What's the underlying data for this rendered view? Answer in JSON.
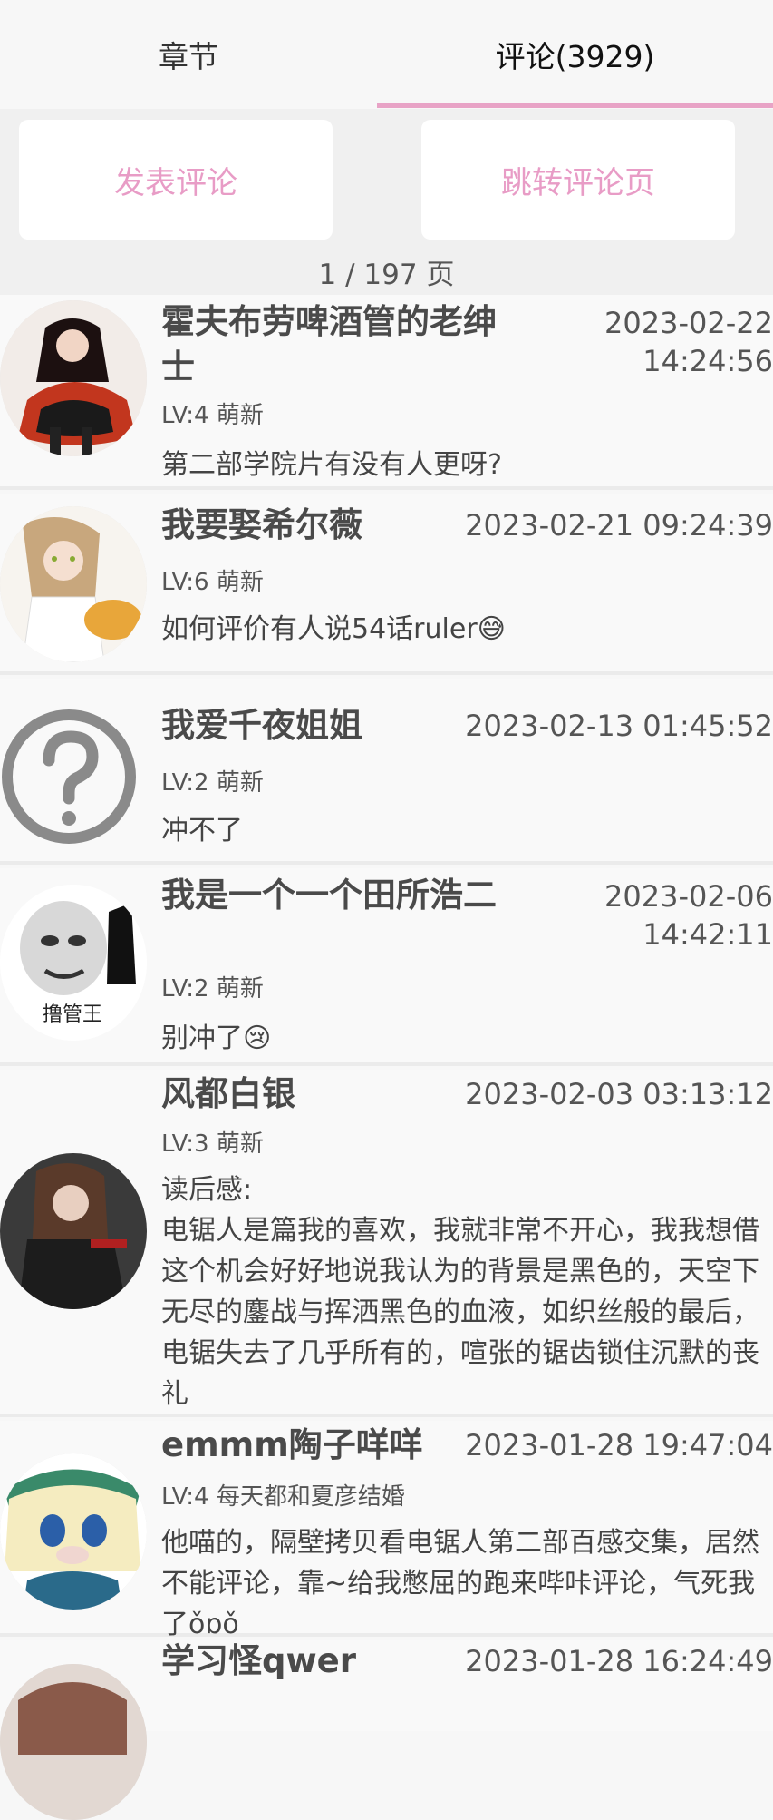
{
  "tabs": {
    "chapters": "章节",
    "comments": "评论(3929)"
  },
  "actions": {
    "post": "发表评论",
    "jump": "跳转评论页"
  },
  "pager": {
    "label": "1 / 197 页"
  },
  "comments": [
    {
      "user": "霍夫布劳啤酒管的老绅士",
      "date": "2023-02-22\n14:24:56",
      "level": "LV:4 萌新",
      "text": "第二部学院片有没有人更呀?"
    },
    {
      "user": "我要娶希尔薇",
      "date": "2023-02-21 09:24:39",
      "level": "LV:6 萌新",
      "text": "如何评价有人说54话ruler😅"
    },
    {
      "user": "我爱千夜姐姐",
      "date": "2023-02-13 01:45:52",
      "level": "LV:2 萌新",
      "text": "冲不了"
    },
    {
      "user": "我是一个一个田所浩二",
      "date": "2023-02-06\n14:42:11",
      "level": "LV:2 萌新",
      "text": "别冲了😢",
      "avatar_caption": "撸管王"
    },
    {
      "user": "风都白银",
      "date": "2023-02-03 03:13:12",
      "level": "LV:3 萌新",
      "text": "读后感:\n电锯人是篇我的喜欢，我就非常不开心，我我想借这个机会好好地说我认为的背景是黑色的，天空下无尽的鏖战与挥洒黑色的血液，如织丝般的最后，电锯失去了几乎所有的，喧张的锯齿锁住沉默的丧礼"
    },
    {
      "user": "emmm陶子咩咩",
      "date": "2023-01-28 19:47:04",
      "level": "LV:4 每天都和夏彦结婚",
      "text": "他喵的，隔壁拷贝看电锯人第二部百感交集，居然不能评论，靠~给我憋屈的跑来哔咔评论，气死我了ǒɒǒ"
    },
    {
      "user": "学习怪qwer",
      "date": "2023-01-28 16:24:49",
      "level": "",
      "text": ""
    }
  ]
}
